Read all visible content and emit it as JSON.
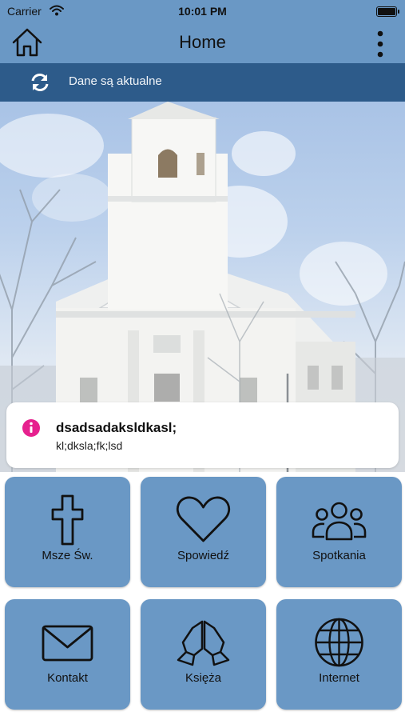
{
  "status_bar": {
    "carrier": "Carrier",
    "time": "10:01 PM"
  },
  "nav": {
    "title": "Home"
  },
  "sync": {
    "text": "Dane są aktualne"
  },
  "notice": {
    "title": "dsadsadaksldkasl;",
    "body": "kl;dksla;fk;lsd",
    "icon_color": "#e6218e"
  },
  "colors": {
    "bar": "#6a98c5",
    "sync_bar": "#2d5b8a",
    "tile": "#6a98c5"
  },
  "tiles": [
    {
      "label": "Msze Św.",
      "icon": "cross-icon"
    },
    {
      "label": "Spowiedź",
      "icon": "heart-icon"
    },
    {
      "label": "Spotkania",
      "icon": "group-icon"
    },
    {
      "label": "Kontakt",
      "icon": "envelope-icon"
    },
    {
      "label": "Księża",
      "icon": "praying-hands-icon"
    },
    {
      "label": "Internet",
      "icon": "globe-icon"
    }
  ]
}
